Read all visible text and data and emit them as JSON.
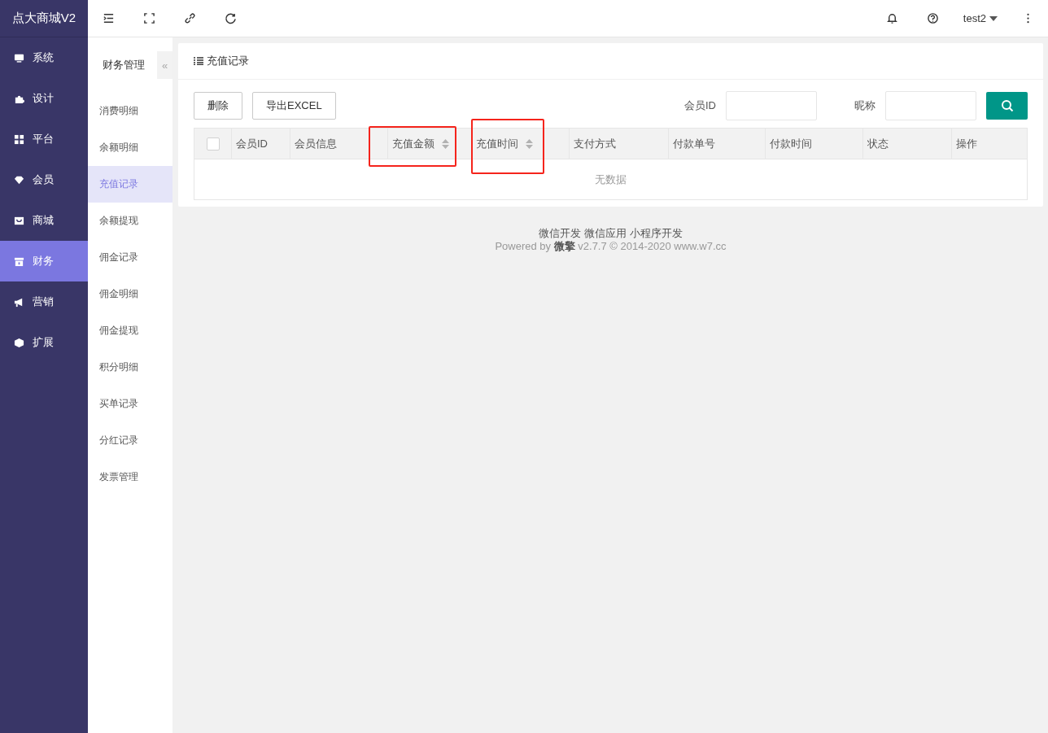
{
  "brand": "点大商城V2",
  "main_menu": [
    {
      "label": "系统",
      "selected": false
    },
    {
      "label": "设计",
      "selected": false
    },
    {
      "label": "平台",
      "selected": false
    },
    {
      "label": "会员",
      "selected": false
    },
    {
      "label": "商城",
      "selected": false
    },
    {
      "label": "财务",
      "selected": true
    },
    {
      "label": "营销",
      "selected": false
    },
    {
      "label": "扩展",
      "selected": false
    }
  ],
  "user": {
    "name": "test2"
  },
  "submenu": {
    "title": "财务管理",
    "collapse": "«",
    "items": [
      {
        "label": "消费明细",
        "selected": false
      },
      {
        "label": "余额明细",
        "selected": false
      },
      {
        "label": "充值记录",
        "selected": true
      },
      {
        "label": "余额提现",
        "selected": false
      },
      {
        "label": "佣金记录",
        "selected": false
      },
      {
        "label": "佣金明细",
        "selected": false
      },
      {
        "label": "佣金提现",
        "selected": false
      },
      {
        "label": "积分明细",
        "selected": false
      },
      {
        "label": "买单记录",
        "selected": false
      },
      {
        "label": "分红记录",
        "selected": false
      },
      {
        "label": "发票管理",
        "selected": false
      }
    ]
  },
  "card": {
    "title": "充值记录",
    "buttons": [
      "删除",
      "导出EXCEL"
    ],
    "filters": [
      {
        "label": "会员ID"
      },
      {
        "label": "昵称"
      }
    ],
    "table": {
      "columns": [
        {
          "label": "会员ID",
          "sortable": false,
          "highlighted": false
        },
        {
          "label": "会员信息",
          "sortable": false,
          "highlighted": false
        },
        {
          "label": "充值金额",
          "sortable": true,
          "highlighted": true
        },
        {
          "label": "充值时间",
          "sortable": true,
          "highlighted": true
        },
        {
          "label": "支付方式",
          "sortable": false,
          "highlighted": false
        },
        {
          "label": "付款单号",
          "sortable": false,
          "highlighted": false
        },
        {
          "label": "付款时间",
          "sortable": false,
          "highlighted": false
        },
        {
          "label": "状态",
          "sortable": false,
          "highlighted": false
        },
        {
          "label": "操作",
          "sortable": false,
          "highlighted": false
        }
      ],
      "select_all_checked": false,
      "empty_text": "无数据"
    }
  },
  "footer": {
    "links": [
      "微信开发",
      "微信应用",
      "小程序开发"
    ],
    "powered": "Powered by **微擎** v2.7.7 © 2014-2020 www.w7.cc"
  }
}
